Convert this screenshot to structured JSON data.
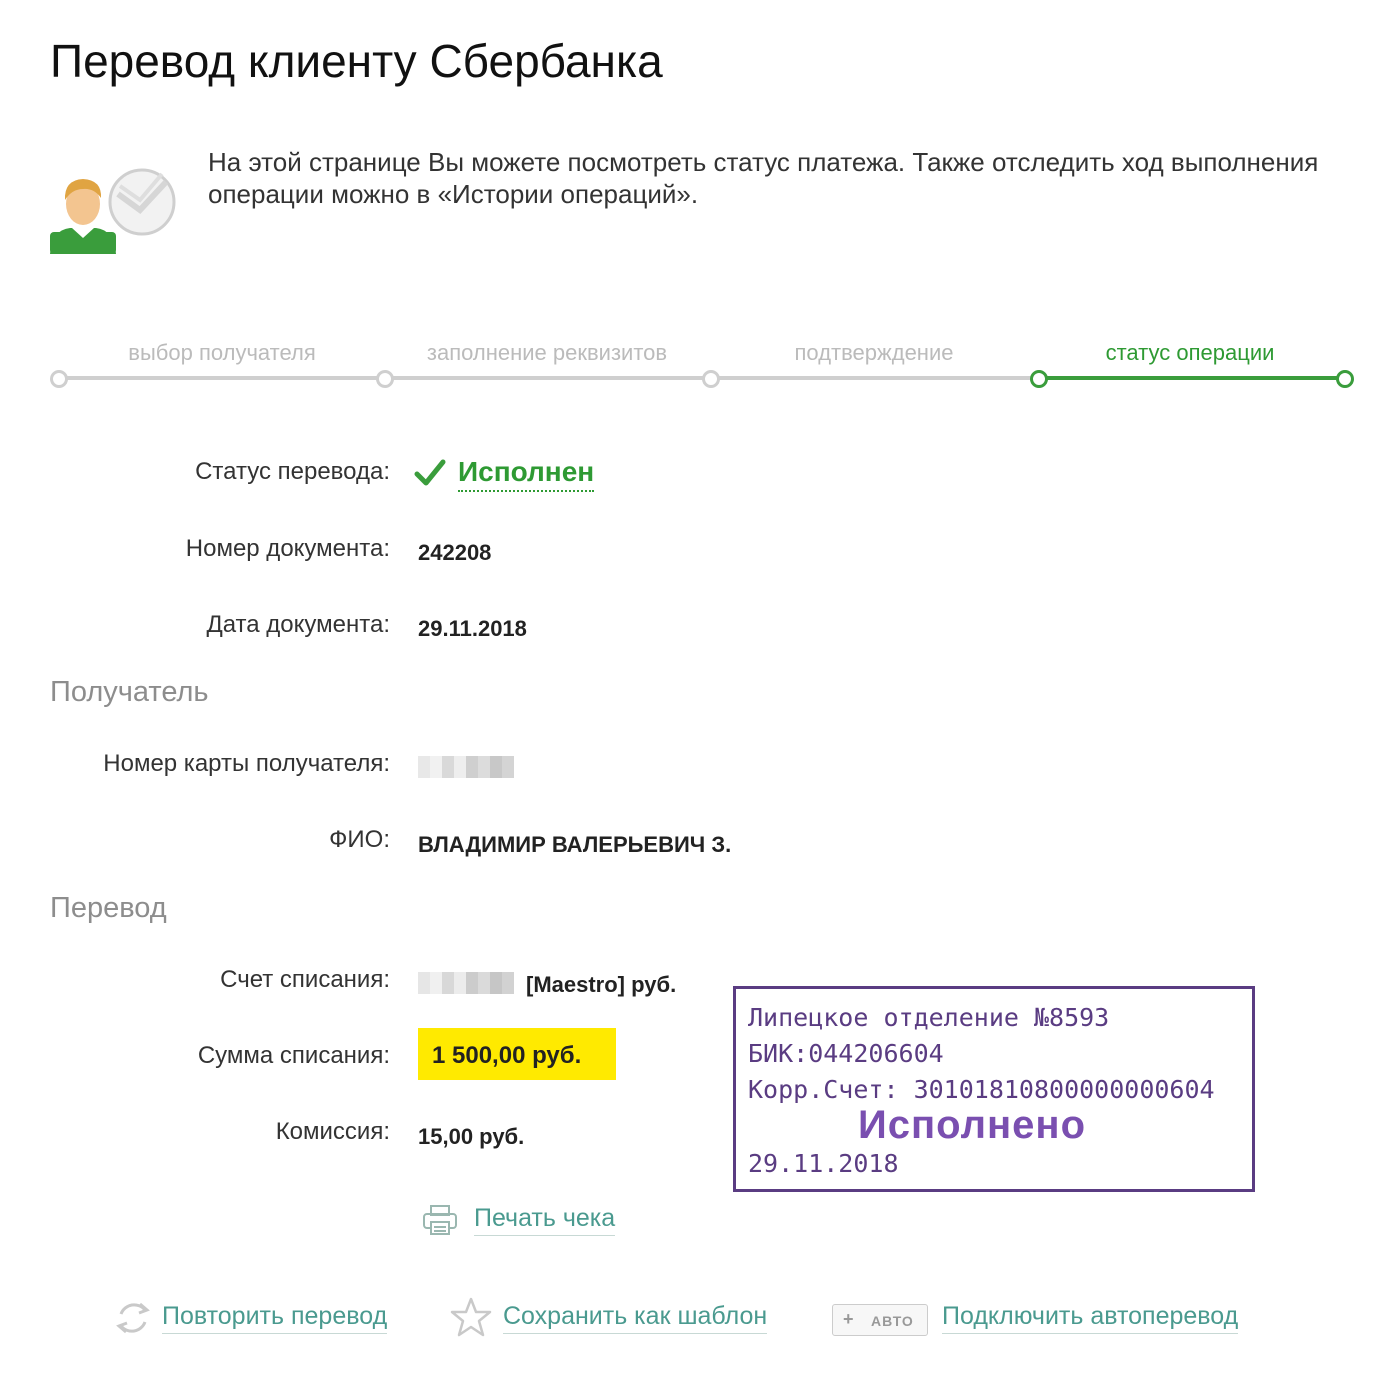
{
  "page": {
    "title": "Перевод клиенту Сбербанка"
  },
  "intro": {
    "text": "На этой странице Вы можете посмотреть статус платежа. Также отследить ход выполнения операции можно в «Истории операций»."
  },
  "steps": [
    {
      "label": "выбор получателя",
      "active": false
    },
    {
      "label": "заполнение реквизитов",
      "active": false
    },
    {
      "label": "подтверждение",
      "active": false
    },
    {
      "label": "статус операции",
      "active": true
    }
  ],
  "details": {
    "status_label": "Статус перевода:",
    "status_value": "Исполнен",
    "doc_number_label": "Номер документа:",
    "doc_number_value": "242208",
    "doc_date_label": "Дата документа:",
    "doc_date_value": "29.11.2018"
  },
  "recipient": {
    "heading": "Получатель",
    "card_label": "Номер карты получателя:",
    "name_label": "ФИО:",
    "name_value": "ВЛАДИМИР ВАЛЕРЬЕВИЧ З."
  },
  "transfer": {
    "heading": "Перевод",
    "account_label": "Счет списания:",
    "account_suffix": "[Maestro]  руб.",
    "amount_label": "Сумма списания:",
    "amount_value": "1 500,00  руб.",
    "fee_label": "Комиссия:",
    "fee_value": "15,00 руб."
  },
  "print_link": "Печать чека",
  "stamp": {
    "line1": "Липецкое отделение №8593",
    "line2": "БИК:044206604",
    "line3": "Корр.Счет: 30101810800000000604",
    "status": "Исполнено",
    "date": "29.11.2018"
  },
  "actions": {
    "repeat": "Повторить перевод",
    "save_template": "Сохранить как шаблон",
    "auto_badge": "АВТО",
    "auto_connect": "Подключить автоперевод"
  },
  "colors": {
    "accent_green": "#2e9a33",
    "link": "#4a9a8f",
    "highlight": "#ffea00",
    "stamp": "#5a3c82"
  }
}
